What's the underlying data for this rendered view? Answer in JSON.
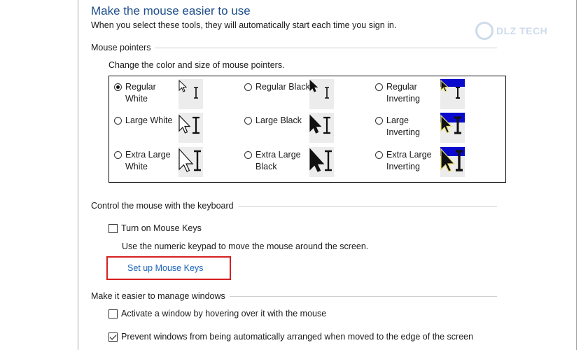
{
  "title": "Make the mouse easier to use",
  "subtitle": "When you select these tools, they will automatically start each time you sign in.",
  "watermark": "DLZ TECH",
  "pointers_section": {
    "header": "Mouse pointers",
    "description": "Change the color and size of mouse pointers.",
    "options": [
      {
        "line1": "Regular",
        "line2": "White",
        "checked": true,
        "scheme": "white"
      },
      {
        "line1": "Regular Black",
        "line2": "",
        "checked": false,
        "scheme": "black"
      },
      {
        "line1": "Regular",
        "line2": "Inverting",
        "checked": false,
        "scheme": "inverting"
      },
      {
        "line1": "Large White",
        "line2": "",
        "checked": false,
        "scheme": "white"
      },
      {
        "line1": "Large Black",
        "line2": "",
        "checked": false,
        "scheme": "black"
      },
      {
        "line1": "Large",
        "line2": "Inverting",
        "checked": false,
        "scheme": "inverting"
      },
      {
        "line1": "Extra Large",
        "line2": "White",
        "checked": false,
        "scheme": "white"
      },
      {
        "line1": "Extra Large",
        "line2": "Black",
        "checked": false,
        "scheme": "black"
      },
      {
        "line1": "Extra Large",
        "line2": "Inverting",
        "checked": false,
        "scheme": "inverting"
      }
    ]
  },
  "keyboard_section": {
    "header": "Control the mouse with the keyboard",
    "mouse_keys_label": "Turn on Mouse Keys",
    "mouse_keys_checked": false,
    "mouse_keys_description": "Use the numeric keypad to move the mouse around the screen.",
    "setup_link": "Set up Mouse Keys"
  },
  "windows_section": {
    "header": "Make it easier to manage windows",
    "hover_label": "Activate a window by hovering over it with the mouse",
    "hover_checked": false,
    "prevent_label": "Prevent windows from being automatically arranged when moved to the edge of the screen",
    "prevent_checked": true
  },
  "colors": {
    "title": "#1e4e8c",
    "link": "#1a64b8",
    "highlight": "#d62020",
    "inverting_blue": "#0a0acc",
    "inverting_yellow": "#e8e070"
  }
}
